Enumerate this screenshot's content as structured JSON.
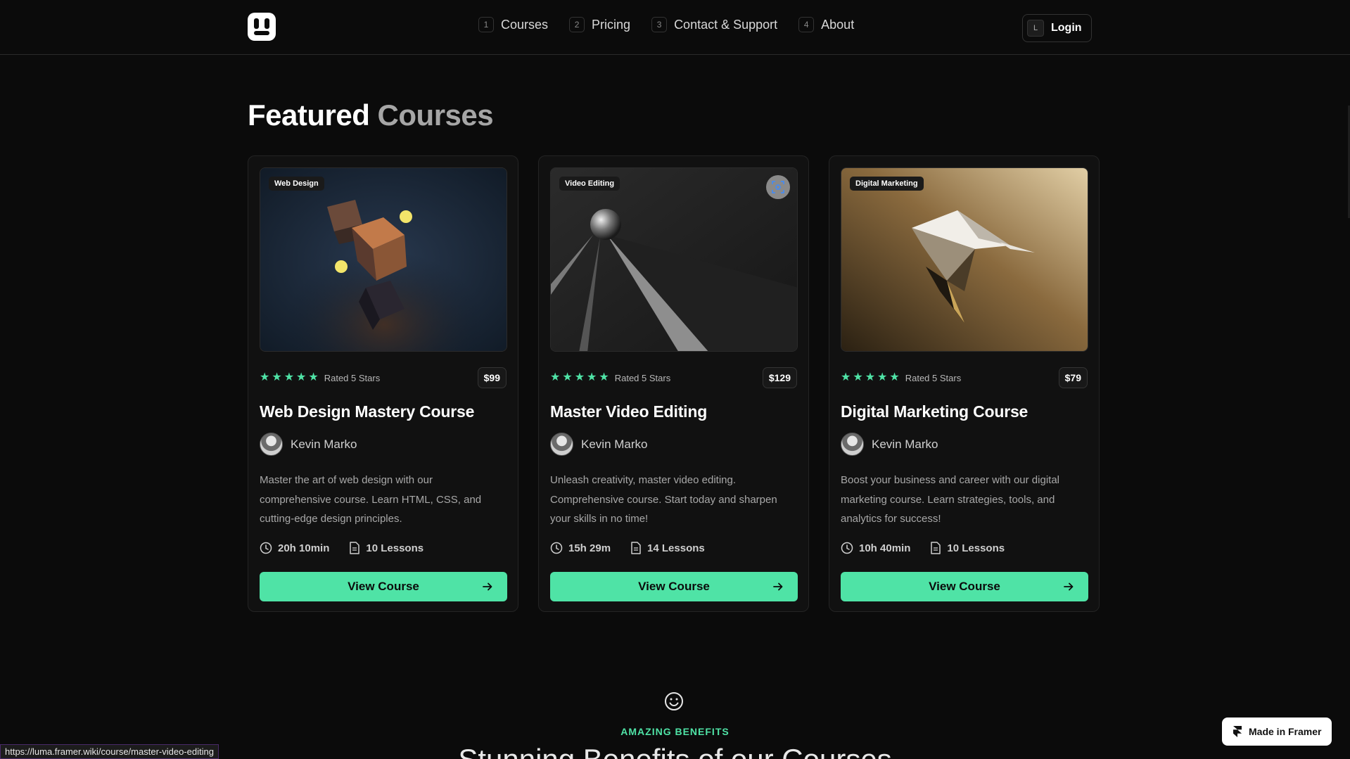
{
  "nav": {
    "links": [
      {
        "num": "1",
        "label": "Courses"
      },
      {
        "num": "2",
        "label": "Pricing"
      },
      {
        "num": "3",
        "label": "Contact & Support"
      },
      {
        "num": "4",
        "label": "About"
      }
    ],
    "login_key": "L",
    "login_label": "Login"
  },
  "section": {
    "title_bold": "Featured",
    "title_muted": "Courses"
  },
  "courses": [
    {
      "tag": "Web Design",
      "rating_text": "Rated 5 Stars",
      "price": "$99",
      "title": "Web Design Mastery Course",
      "author": "Kevin Marko",
      "description": "Master the art of web design with our comprehensive course. Learn HTML, CSS, and cutting-edge design principles.",
      "duration": "20h 10min",
      "lessons": "10 Lessons",
      "cta": "View Course",
      "rating": 5
    },
    {
      "tag": "Video Editing",
      "rating_text": "Rated 5 Stars",
      "price": "$129",
      "title": "Master Video Editing",
      "author": "Kevin Marko",
      "description": "Unleash creativity, master video editing. Comprehensive course. Start today and sharpen your skills in no time!",
      "duration": "15h 29m",
      "lessons": "14 Lessons",
      "cta": "View Course",
      "rating": 5
    },
    {
      "tag": "Digital Marketing",
      "rating_text": "Rated 5 Stars",
      "price": "$79",
      "title": "Digital Marketing Course",
      "author": "Kevin Marko",
      "description": "Boost your business and career with our digital marketing course. Learn strategies, tools, and analytics for success!",
      "duration": "10h 40min",
      "lessons": "10 Lessons",
      "cta": "View Course",
      "rating": 5
    }
  ],
  "benefits": {
    "eyebrow": "AMAZING BENEFITS",
    "title": "Stunning Benefits of our Courses"
  },
  "status_url": "https://luma.framer.wiki/course/master-video-editing",
  "framer_badge": "Made in Framer",
  "colors": {
    "accent": "#4fe3a6",
    "background": "#0b0b0b",
    "card": "#111111"
  }
}
